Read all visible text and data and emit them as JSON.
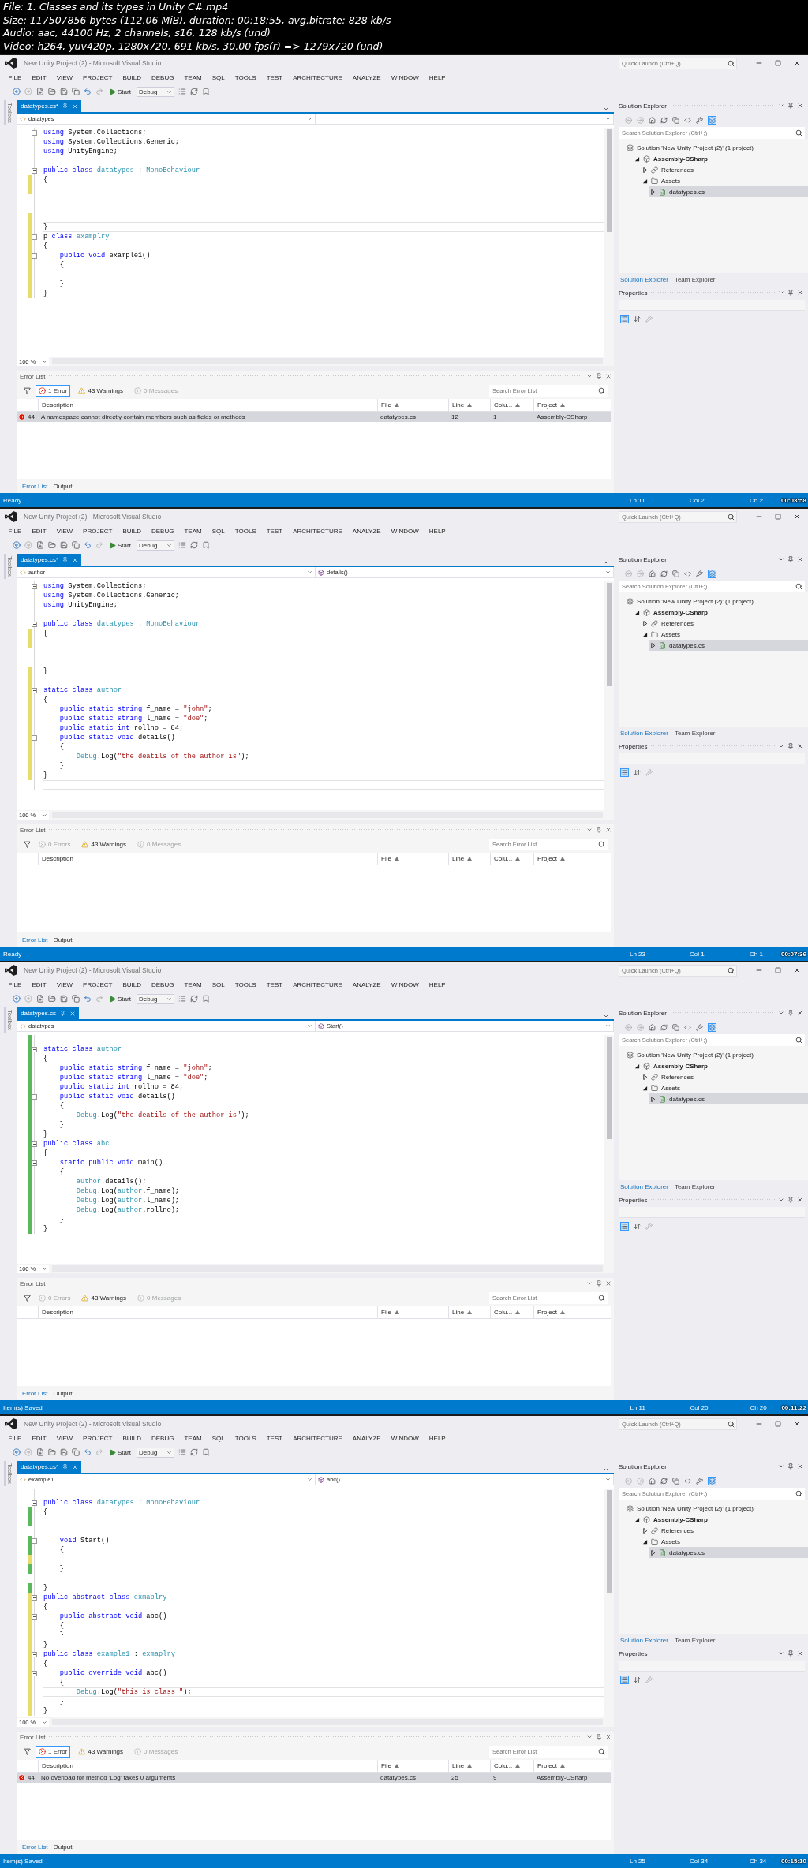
{
  "header": {
    "lines": [
      "File: 1. Classes and its types in Unity C#.mp4",
      "Size: 117507856 bytes (112.06 MiB), duration: 00:18:55, avg.bitrate: 828 kb/s",
      "Audio: aac, 44100 Hz, 2 channels, s16, 128 kb/s (und)",
      "Video: h264, yuv420p, 1280x720, 691 kb/s, 30.00 fps(r) => 1279x720 (und)"
    ]
  },
  "frames": [
    {
      "window": {
        "title": "New Unity Project (2) - Microsoft Visual Studio",
        "quick_launch": {
          "placeholder": "Quick Launch (Ctrl+Q)"
        }
      },
      "menu": [
        "FILE",
        "EDIT",
        "VIEW",
        "PROJECT",
        "BUILD",
        "DEBUG",
        "TEAM",
        "SQL",
        "TOOLS",
        "TEST",
        "ARCHITECTURE",
        "ANALYZE",
        "WINDOW",
        "HELP"
      ],
      "toolbar": {
        "start": "Start",
        "configuration": "Debug"
      },
      "toolbox": "Toolbox",
      "document_tab": {
        "label": "datatypes.cs*",
        "selected": true
      },
      "navigation": {
        "type": "datatypes"
      },
      "editor": {
        "lines": [
          {
            "fold": true,
            "current": false,
            "tokens": [
              {
                "kind": "keyword",
                "text": "using"
              },
              {
                "kind": "plain",
                "text": " System.Collections;"
              }
            ]
          },
          {
            "fold": false,
            "current": false,
            "tokens": [
              {
                "kind": "keyword",
                "text": "using"
              },
              {
                "kind": "plain",
                "text": " System.Collections.Generic;"
              }
            ]
          },
          {
            "fold": false,
            "current": false,
            "tokens": [
              {
                "kind": "keyword",
                "text": "using"
              },
              {
                "kind": "plain",
                "text": " UnityEngine;"
              }
            ]
          },
          {
            "fold": false,
            "current": false
          },
          {
            "fold": true,
            "current": false,
            "tokens": [
              {
                "kind": "keyword",
                "text": "public class "
              },
              {
                "kind": "type",
                "text": "datatypes"
              },
              {
                "kind": "plain",
                "text": " : "
              },
              {
                "kind": "type",
                "text": "MonoBehaviour"
              }
            ]
          },
          {
            "fold": false,
            "color": "#e8dc6a",
            "current": false,
            "tokens": [
              {
                "kind": "plain",
                "text": "{"
              }
            ]
          },
          {
            "fold": false,
            "color": "#e8dc6a",
            "current": false
          },
          {
            "fold": false,
            "current": false
          },
          {
            "fold": false,
            "current": false
          },
          {
            "fold": false,
            "color": "#e8dc6a",
            "current": false
          },
          {
            "fold": false,
            "color": "#e8dc6a",
            "current": true,
            "tokens": [
              {
                "kind": "plain",
                "text": "}"
              }
            ]
          },
          {
            "fold": true,
            "color": "#e8dc6a",
            "current": false,
            "tokens": [
              {
                "kind": "plain",
                "text": "p "
              },
              {
                "kind": "keyword",
                "text": "class "
              },
              {
                "kind": "type",
                "text": "examplry"
              }
            ]
          },
          {
            "fold": false,
            "color": "#e8dc6a",
            "current": false,
            "tokens": [
              {
                "kind": "plain",
                "text": "{"
              }
            ]
          },
          {
            "fold": true,
            "color": "#e8dc6a",
            "current": false,
            "tokens": [
              {
                "kind": "keyword",
                "text": "    public void"
              },
              {
                "kind": "plain",
                "text": " example1()"
              }
            ]
          },
          {
            "fold": false,
            "color": "#e8dc6a",
            "current": false,
            "tokens": [
              {
                "kind": "plain",
                "text": "    {"
              }
            ]
          },
          {
            "fold": false,
            "color": "#e8dc6a",
            "current": false
          },
          {
            "fold": false,
            "color": "#e8dc6a",
            "current": false,
            "tokens": [
              {
                "kind": "plain",
                "text": "    }"
              }
            ]
          },
          {
            "fold": false,
            "color": "#e8dc6a",
            "current": false,
            "tokens": [
              {
                "kind": "plain",
                "text": "}"
              }
            ]
          }
        ]
      },
      "zoom": "100 %",
      "error_list": {
        "title": "Error List",
        "filters": [
          {
            "kind": "error",
            "label": "1 Error",
            "selected": true,
            "disabled": false
          },
          {
            "kind": "warning",
            "label": "43 Warnings",
            "selected": false,
            "disabled": false
          },
          {
            "kind": "message",
            "label": "0 Messages",
            "selected": false,
            "disabled": true
          }
        ],
        "search": {
          "placeholder": "Search Error List"
        },
        "columns": [
          "Description",
          "File",
          "Line",
          "Colu...",
          "Project"
        ],
        "rows": [
          {
            "code": "44",
            "description": "A namespace cannot directly contain members such as fields or methods",
            "file": "datatypes.cs",
            "line": "12",
            "column": "1",
            "project": "Assembly-CSharp",
            "selected": true
          }
        ]
      },
      "bottom_tabs": [
        {
          "label": "Error List",
          "selected": true
        },
        {
          "label": "Output",
          "selected": false
        }
      ],
      "solution_explorer": {
        "title": "Solution Explorer",
        "search": {
          "placeholder": "Search Solution Explorer (Ctrl+;)"
        },
        "tree": [
          {
            "kind": "solution",
            "label": "Solution 'New Unity Project (2)' (1 project)",
            "selected": false,
            "children": [
              {
                "kind": "project",
                "label": "Assembly-CSharp",
                "expanded": true,
                "selected": false,
                "children": [
                  {
                    "kind": "references",
                    "label": "References",
                    "expanded": false,
                    "selected": false
                  },
                  {
                    "kind": "folder",
                    "label": "Assets",
                    "expanded": true,
                    "selected": false,
                    "children": [
                      {
                        "kind": "file",
                        "label": "datatypes.cs",
                        "expanded": false,
                        "selected": true
                      }
                    ]
                  }
                ]
              }
            ]
          }
        ],
        "tabs": [
          {
            "label": "Solution Explorer",
            "selected": true
          },
          {
            "label": "Team Explorer",
            "selected": false
          }
        ]
      },
      "properties": {
        "title": "Properties"
      },
      "status_bar": {
        "message": "Ready",
        "line": "Ln 11",
        "column": "Col 2",
        "char": "Ch 2",
        "timestamp": "00:03:58"
      }
    },
    {
      "window": {
        "title": "New Unity Project (2) - Microsoft Visual Studio",
        "quick_launch": {
          "placeholder": "Quick Launch (Ctrl+Q)"
        }
      },
      "menu": [
        "FILE",
        "EDIT",
        "VIEW",
        "PROJECT",
        "BUILD",
        "DEBUG",
        "TEAM",
        "SQL",
        "TOOLS",
        "TEST",
        "ARCHITECTURE",
        "ANALYZE",
        "WINDOW",
        "HELP"
      ],
      "toolbar": {
        "start": "Start",
        "configuration": "Debug"
      },
      "toolbox": "Toolbox",
      "document_tab": {
        "label": "datatypes.cs*",
        "selected": true
      },
      "navigation": {
        "type": "author",
        "member": "details()"
      },
      "editor": {
        "lines": [
          {
            "fold": true,
            "current": false,
            "tokens": [
              {
                "kind": "keyword",
                "text": "using"
              },
              {
                "kind": "plain",
                "text": " System.Collections;"
              }
            ]
          },
          {
            "fold": false,
            "current": false,
            "tokens": [
              {
                "kind": "keyword",
                "text": "using"
              },
              {
                "kind": "plain",
                "text": " System.Collections.Generic;"
              }
            ]
          },
          {
            "fold": false,
            "current": false,
            "tokens": [
              {
                "kind": "keyword",
                "text": "using"
              },
              {
                "kind": "plain",
                "text": " UnityEngine;"
              }
            ]
          },
          {
            "fold": false,
            "current": false
          },
          {
            "fold": true,
            "current": false,
            "tokens": [
              {
                "kind": "keyword",
                "text": "public class "
              },
              {
                "kind": "type",
                "text": "datatypes"
              },
              {
                "kind": "plain",
                "text": " : "
              },
              {
                "kind": "type",
                "text": "MonoBehaviour"
              }
            ]
          },
          {
            "fold": false,
            "color": "#e8dc6a",
            "current": false,
            "tokens": [
              {
                "kind": "plain",
                "text": "{"
              }
            ]
          },
          {
            "fold": false,
            "color": "#e8dc6a",
            "current": false
          },
          {
            "fold": false,
            "current": false
          },
          {
            "fold": false,
            "current": false
          },
          {
            "fold": false,
            "color": "#e8dc6a",
            "current": false,
            "tokens": [
              {
                "kind": "plain",
                "text": "}"
              }
            ]
          },
          {
            "fold": false,
            "color": "#e8dc6a",
            "current": false
          },
          {
            "fold": true,
            "color": "#e8dc6a",
            "current": false,
            "tokens": [
              {
                "kind": "keyword",
                "text": "static class "
              },
              {
                "kind": "type",
                "text": "author"
              }
            ]
          },
          {
            "fold": false,
            "color": "#e8dc6a",
            "current": false,
            "tokens": [
              {
                "kind": "plain",
                "text": "{"
              }
            ]
          },
          {
            "fold": false,
            "color": "#e8dc6a",
            "current": false,
            "tokens": [
              {
                "kind": "keyword",
                "text": "    public static string"
              },
              {
                "kind": "plain",
                "text": " f_name = "
              },
              {
                "kind": "string",
                "text": "\"john\""
              },
              {
                "kind": "plain",
                "text": ";"
              }
            ]
          },
          {
            "fold": false,
            "color": "#e8dc6a",
            "current": false,
            "tokens": [
              {
                "kind": "keyword",
                "text": "    public static string"
              },
              {
                "kind": "plain",
                "text": " l_name = "
              },
              {
                "kind": "string",
                "text": "\"doe\""
              },
              {
                "kind": "plain",
                "text": ";"
              }
            ]
          },
          {
            "fold": false,
            "color": "#e8dc6a",
            "current": false,
            "tokens": [
              {
                "kind": "keyword",
                "text": "    public static int"
              },
              {
                "kind": "plain",
                "text": " rollno = 84;"
              }
            ]
          },
          {
            "fold": true,
            "color": "#e8dc6a",
            "current": false,
            "tokens": [
              {
                "kind": "keyword",
                "text": "    public static void"
              },
              {
                "kind": "plain",
                "text": " details()"
              }
            ]
          },
          {
            "fold": false,
            "color": "#e8dc6a",
            "current": false,
            "tokens": [
              {
                "kind": "plain",
                "text": "    {"
              }
            ]
          },
          {
            "fold": false,
            "color": "#e8dc6a",
            "current": false,
            "tokens": [
              {
                "kind": "type",
                "text": "        Debug"
              },
              {
                "kind": "plain",
                "text": ".Log("
              },
              {
                "kind": "string",
                "text": "\"the deatils of the author is\""
              },
              {
                "kind": "plain",
                "text": ");"
              }
            ]
          },
          {
            "fold": false,
            "color": "#e8dc6a",
            "current": false,
            "tokens": [
              {
                "kind": "plain",
                "text": "    }"
              }
            ]
          },
          {
            "fold": false,
            "color": "#e8dc6a",
            "current": false,
            "tokens": [
              {
                "kind": "plain",
                "text": "}"
              }
            ]
          },
          {
            "fold": false,
            "current": true
          }
        ]
      },
      "zoom": "100 %",
      "error_list": {
        "title": "Error List",
        "filters": [
          {
            "kind": "error",
            "label": "0 Errors",
            "selected": false,
            "disabled": true
          },
          {
            "kind": "warning",
            "label": "43 Warnings",
            "selected": false,
            "disabled": false
          },
          {
            "kind": "message",
            "label": "0 Messages",
            "selected": false,
            "disabled": true
          }
        ],
        "search": {
          "placeholder": "Search Error List"
        },
        "columns": [
          "Description",
          "File",
          "Line",
          "Colu...",
          "Project"
        ]
      },
      "bottom_tabs": [
        {
          "label": "Error List",
          "selected": true
        },
        {
          "label": "Output",
          "selected": false
        }
      ],
      "solution_explorer": {
        "title": "Solution Explorer",
        "search": {
          "placeholder": "Search Solution Explorer (Ctrl+;)"
        },
        "tree": [
          {
            "kind": "solution",
            "label": "Solution 'New Unity Project (2)' (1 project)",
            "selected": false,
            "children": [
              {
                "kind": "project",
                "label": "Assembly-CSharp",
                "expanded": true,
                "selected": false,
                "children": [
                  {
                    "kind": "references",
                    "label": "References",
                    "expanded": false,
                    "selected": false
                  },
                  {
                    "kind": "folder",
                    "label": "Assets",
                    "expanded": true,
                    "selected": false,
                    "children": [
                      {
                        "kind": "file",
                        "label": "datatypes.cs",
                        "expanded": false,
                        "selected": true
                      }
                    ]
                  }
                ]
              }
            ]
          }
        ],
        "tabs": [
          {
            "label": "Solution Explorer",
            "selected": true
          },
          {
            "label": "Team Explorer",
            "selected": false
          }
        ]
      },
      "properties": {
        "title": "Properties"
      },
      "status_bar": {
        "message": "Ready",
        "line": "Ln 23",
        "column": "Col 1",
        "char": "Ch 1",
        "timestamp": "00:07:36"
      }
    },
    {
      "window": {
        "title": "New Unity Project (2) - Microsoft Visual Studio",
        "quick_launch": {
          "placeholder": "Quick Launch (Ctrl+Q)"
        }
      },
      "menu": [
        "FILE",
        "EDIT",
        "VIEW",
        "PROJECT",
        "BUILD",
        "DEBUG",
        "TEAM",
        "SQL",
        "TOOLS",
        "TEST",
        "ARCHITECTURE",
        "ANALYZE",
        "WINDOW",
        "HELP"
      ],
      "toolbar": {
        "start": "Start",
        "configuration": "Debug"
      },
      "toolbox": "Toolbox",
      "document_tab": {
        "label": "datatypes.cs",
        "selected": true
      },
      "navigation": {
        "type": "datatypes",
        "member": "Start()"
      },
      "editor": {
        "lines": [
          {
            "fold": false,
            "color": "#5cb85c",
            "current": false
          },
          {
            "fold": true,
            "color": "#5cb85c",
            "current": false,
            "tokens": [
              {
                "kind": "keyword",
                "text": "static class "
              },
              {
                "kind": "type",
                "text": "author"
              }
            ]
          },
          {
            "fold": false,
            "color": "#5cb85c",
            "current": false,
            "tokens": [
              {
                "kind": "plain",
                "text": "{"
              }
            ]
          },
          {
            "fold": false,
            "color": "#5cb85c",
            "current": false,
            "tokens": [
              {
                "kind": "keyword",
                "text": "    public static string"
              },
              {
                "kind": "plain",
                "text": " f_name = "
              },
              {
                "kind": "string",
                "text": "\"john\""
              },
              {
                "kind": "plain",
                "text": ";"
              }
            ]
          },
          {
            "fold": false,
            "color": "#5cb85c",
            "current": false,
            "tokens": [
              {
                "kind": "keyword",
                "text": "    public static string"
              },
              {
                "kind": "plain",
                "text": " l_name = "
              },
              {
                "kind": "string",
                "text": "\"doe\""
              },
              {
                "kind": "plain",
                "text": ";"
              }
            ]
          },
          {
            "fold": false,
            "color": "#5cb85c",
            "current": false,
            "tokens": [
              {
                "kind": "keyword",
                "text": "    public static int"
              },
              {
                "kind": "plain",
                "text": " rollno = 84;"
              }
            ]
          },
          {
            "fold": true,
            "color": "#5cb85c",
            "current": false,
            "tokens": [
              {
                "kind": "keyword",
                "text": "    public static void"
              },
              {
                "kind": "plain",
                "text": " details()"
              }
            ]
          },
          {
            "fold": false,
            "color": "#5cb85c",
            "current": false,
            "tokens": [
              {
                "kind": "plain",
                "text": "    {"
              }
            ]
          },
          {
            "fold": false,
            "color": "#5cb85c",
            "current": false,
            "tokens": [
              {
                "kind": "type",
                "text": "        Debug"
              },
              {
                "kind": "plain",
                "text": ".Log("
              },
              {
                "kind": "string",
                "text": "\"the deatils of the author is\""
              },
              {
                "kind": "plain",
                "text": ");"
              }
            ]
          },
          {
            "fold": false,
            "color": "#5cb85c",
            "current": false,
            "tokens": [
              {
                "kind": "plain",
                "text": "    }"
              }
            ]
          },
          {
            "fold": false,
            "color": "#5cb85c",
            "current": false,
            "tokens": [
              {
                "kind": "plain",
                "text": "}"
              }
            ]
          },
          {
            "fold": true,
            "color": "#5cb85c",
            "current": false,
            "tokens": [
              {
                "kind": "keyword",
                "text": "public class "
              },
              {
                "kind": "type",
                "text": "abc"
              }
            ]
          },
          {
            "fold": false,
            "color": "#5cb85c",
            "current": false,
            "tokens": [
              {
                "kind": "plain",
                "text": "{"
              }
            ]
          },
          {
            "fold": true,
            "color": "#5cb85c",
            "current": false,
            "tokens": [
              {
                "kind": "keyword",
                "text": "    static public void"
              },
              {
                "kind": "plain",
                "text": " main()"
              }
            ]
          },
          {
            "fold": false,
            "color": "#5cb85c",
            "current": false,
            "tokens": [
              {
                "kind": "plain",
                "text": "    {"
              }
            ]
          },
          {
            "fold": false,
            "color": "#5cb85c",
            "current": false,
            "tokens": [
              {
                "kind": "type",
                "text": "        author"
              },
              {
                "kind": "plain",
                "text": ".details();"
              }
            ]
          },
          {
            "fold": false,
            "color": "#5cb85c",
            "current": false,
            "tokens": [
              {
                "kind": "type",
                "text": "        Debug"
              },
              {
                "kind": "plain",
                "text": ".Log("
              },
              {
                "kind": "type",
                "text": "author"
              },
              {
                "kind": "plain",
                "text": ".f_name);"
              }
            ]
          },
          {
            "fold": false,
            "color": "#5cb85c",
            "current": false,
            "tokens": [
              {
                "kind": "type",
                "text": "        Debug"
              },
              {
                "kind": "plain",
                "text": ".Log("
              },
              {
                "kind": "type",
                "text": "author"
              },
              {
                "kind": "plain",
                "text": ".l_name);"
              }
            ]
          },
          {
            "fold": false,
            "color": "#5cb85c",
            "current": false,
            "tokens": [
              {
                "kind": "type",
                "text": "        Debug"
              },
              {
                "kind": "plain",
                "text": ".Log("
              },
              {
                "kind": "type",
                "text": "author"
              },
              {
                "kind": "plain",
                "text": ".rollno);"
              }
            ]
          },
          {
            "fold": false,
            "color": "#5cb85c",
            "current": false,
            "tokens": [
              {
                "kind": "plain",
                "text": "    }"
              }
            ]
          },
          {
            "fold": false,
            "color": "#5cb85c",
            "current": false,
            "tokens": [
              {
                "kind": "plain",
                "text": "}"
              }
            ]
          }
        ]
      },
      "zoom": "100 %",
      "error_list": {
        "title": "Error List",
        "filters": [
          {
            "kind": "error",
            "label": "0 Errors",
            "selected": false,
            "disabled": true
          },
          {
            "kind": "warning",
            "label": "43 Warnings",
            "selected": false,
            "disabled": false
          },
          {
            "kind": "message",
            "label": "0 Messages",
            "selected": false,
            "disabled": true
          }
        ],
        "search": {
          "placeholder": "Search Error List"
        },
        "columns": [
          "Description",
          "File",
          "Line",
          "Colu...",
          "Project"
        ]
      },
      "bottom_tabs": [
        {
          "label": "Error List",
          "selected": true
        },
        {
          "label": "Output",
          "selected": false
        }
      ],
      "solution_explorer": {
        "title": "Solution Explorer",
        "search": {
          "placeholder": "Search Solution Explorer (Ctrl+;)"
        },
        "tree": [
          {
            "kind": "solution",
            "label": "Solution 'New Unity Project (2)' (1 project)",
            "selected": false,
            "children": [
              {
                "kind": "project",
                "label": "Assembly-CSharp",
                "expanded": true,
                "selected": false,
                "children": [
                  {
                    "kind": "references",
                    "label": "References",
                    "expanded": false,
                    "selected": false
                  },
                  {
                    "kind": "folder",
                    "label": "Assets",
                    "expanded": true,
                    "selected": false,
                    "children": [
                      {
                        "kind": "file",
                        "label": "datatypes.cs",
                        "expanded": false,
                        "selected": true
                      }
                    ]
                  }
                ]
              }
            ]
          }
        ],
        "tabs": [
          {
            "label": "Solution Explorer",
            "selected": true
          },
          {
            "label": "Team Explorer",
            "selected": false
          }
        ]
      },
      "properties": {
        "title": "Properties"
      },
      "status_bar": {
        "message": "Item(s) Saved",
        "line": "Ln 11",
        "column": "Col 20",
        "char": "Ch 20",
        "timestamp": "00:11:22"
      }
    },
    {
      "window": {
        "title": "New Unity Project (2) - Microsoft Visual Studio",
        "quick_launch": {
          "placeholder": "Quick Launch (Ctrl+Q)"
        }
      },
      "menu": [
        "FILE",
        "EDIT",
        "VIEW",
        "PROJECT",
        "BUILD",
        "DEBUG",
        "TEAM",
        "SQL",
        "TOOLS",
        "TEST",
        "ARCHITECTURE",
        "ANALYZE",
        "WINDOW",
        "HELP"
      ],
      "toolbar": {
        "start": "Start",
        "configuration": "Debug"
      },
      "toolbox": "Toolbox",
      "document_tab": {
        "label": "datatypes.cs*",
        "selected": true
      },
      "navigation": {
        "type": "example1",
        "member": "abc()"
      },
      "editor": {
        "lines": [
          {
            "fold": false,
            "current": false
          },
          {
            "fold": true,
            "current": false,
            "tokens": [
              {
                "kind": "keyword",
                "text": "public class "
              },
              {
                "kind": "type",
                "text": "datatypes"
              },
              {
                "kind": "plain",
                "text": " : "
              },
              {
                "kind": "type",
                "text": "MonoBehaviour"
              }
            ]
          },
          {
            "fold": false,
            "color": "#5cb85c",
            "current": false,
            "tokens": [
              {
                "kind": "plain",
                "text": "{"
              }
            ]
          },
          {
            "fold": false,
            "color": "#5cb85c",
            "current": false
          },
          {
            "fold": false,
            "current": false
          },
          {
            "fold": true,
            "color": "#5cb85c",
            "current": false,
            "tokens": [
              {
                "kind": "keyword",
                "text": "    void"
              },
              {
                "kind": "plain",
                "text": " Start()"
              }
            ]
          },
          {
            "fold": false,
            "color": "#5cb85c",
            "current": false,
            "tokens": [
              {
                "kind": "plain",
                "text": "    {"
              }
            ]
          },
          {
            "fold": false,
            "color": "#e8dc6a",
            "current": false
          },
          {
            "fold": false,
            "color": "#5cb85c",
            "current": false,
            "tokens": [
              {
                "kind": "plain",
                "text": "    }"
              }
            ]
          },
          {
            "fold": false,
            "current": false
          },
          {
            "fold": false,
            "color": "#5cb85c",
            "current": false,
            "tokens": [
              {
                "kind": "plain",
                "text": "}"
              }
            ]
          },
          {
            "fold": true,
            "color": "#e8dc6a",
            "current": false,
            "tokens": [
              {
                "kind": "keyword",
                "text": "public abstract class "
              },
              {
                "kind": "type",
                "text": "exmaplry"
              }
            ]
          },
          {
            "fold": false,
            "color": "#e8dc6a",
            "current": false,
            "tokens": [
              {
                "kind": "plain",
                "text": "{"
              }
            ]
          },
          {
            "fold": true,
            "color": "#e8dc6a",
            "current": false,
            "tokens": [
              {
                "kind": "keyword",
                "text": "    public abstract void"
              },
              {
                "kind": "plain",
                "text": " abc()"
              }
            ]
          },
          {
            "fold": false,
            "color": "#e8dc6a",
            "current": false,
            "tokens": [
              {
                "kind": "plain",
                "text": "    {"
              }
            ]
          },
          {
            "fold": false,
            "color": "#e8dc6a",
            "current": false,
            "tokens": [
              {
                "kind": "plain",
                "text": "    }"
              }
            ]
          },
          {
            "fold": false,
            "color": "#e8dc6a",
            "current": false,
            "tokens": [
              {
                "kind": "plain",
                "text": "}"
              }
            ]
          },
          {
            "fold": true,
            "color": "#e8dc6a",
            "current": false,
            "tokens": [
              {
                "kind": "keyword",
                "text": "public class "
              },
              {
                "kind": "type",
                "text": "example1"
              },
              {
                "kind": "plain",
                "text": " : "
              },
              {
                "kind": "type",
                "text": "exmaplry"
              }
            ]
          },
          {
            "fold": false,
            "color": "#e8dc6a",
            "current": false,
            "tokens": [
              {
                "kind": "plain",
                "text": "{"
              }
            ]
          },
          {
            "fold": true,
            "color": "#e8dc6a",
            "current": false,
            "tokens": [
              {
                "kind": "keyword",
                "text": "    public override void"
              },
              {
                "kind": "plain",
                "text": " abc()"
              }
            ]
          },
          {
            "fold": false,
            "color": "#e8dc6a",
            "current": false,
            "tokens": [
              {
                "kind": "plain",
                "text": "    {"
              }
            ]
          },
          {
            "fold": false,
            "color": "#e8dc6a",
            "current": true,
            "tokens": [
              {
                "kind": "type",
                "text": "        Debug"
              },
              {
                "kind": "plain",
                "text": ".Log("
              },
              {
                "kind": "string",
                "text": "\"this is class \""
              },
              {
                "kind": "plain",
                "text": ");"
              }
            ]
          },
          {
            "fold": false,
            "color": "#e8dc6a",
            "current": false,
            "tokens": [
              {
                "kind": "plain",
                "text": "    }"
              }
            ]
          },
          {
            "fold": false,
            "color": "#e8dc6a",
            "current": false,
            "tokens": [
              {
                "kind": "plain",
                "text": "}"
              }
            ]
          }
        ]
      },
      "zoom": "100 %",
      "error_list": {
        "title": "Error List",
        "filters": [
          {
            "kind": "error",
            "label": "1 Error",
            "selected": true,
            "disabled": false
          },
          {
            "kind": "warning",
            "label": "43 Warnings",
            "selected": false,
            "disabled": false
          },
          {
            "kind": "message",
            "label": "0 Messages",
            "selected": false,
            "disabled": true
          }
        ],
        "search": {
          "placeholder": "Search Error List"
        },
        "columns": [
          "Description",
          "File",
          "Line",
          "Colu...",
          "Project"
        ],
        "rows": [
          {
            "code": "44",
            "description": "No overload for method 'Log' takes 0 arguments",
            "file": "datatypes.cs",
            "line": "25",
            "column": "9",
            "project": "Assembly-CSharp",
            "selected": true
          }
        ]
      },
      "bottom_tabs": [
        {
          "label": "Error List",
          "selected": true
        },
        {
          "label": "Output",
          "selected": false
        }
      ],
      "solution_explorer": {
        "title": "Solution Explorer",
        "search": {
          "placeholder": "Search Solution Explorer (Ctrl+;)"
        },
        "tree": [
          {
            "kind": "solution",
            "label": "Solution 'New Unity Project (2)' (1 project)",
            "selected": false,
            "children": [
              {
                "kind": "project",
                "label": "Assembly-CSharp",
                "expanded": true,
                "selected": false,
                "children": [
                  {
                    "kind": "references",
                    "label": "References",
                    "expanded": false,
                    "selected": false
                  },
                  {
                    "kind": "folder",
                    "label": "Assets",
                    "expanded": true,
                    "selected": false,
                    "children": [
                      {
                        "kind": "file",
                        "label": "datatypes.cs",
                        "expanded": false,
                        "selected": true
                      }
                    ]
                  }
                ]
              }
            ]
          }
        ],
        "tabs": [
          {
            "label": "Solution Explorer",
            "selected": true
          },
          {
            "label": "Team Explorer",
            "selected": false
          }
        ]
      },
      "properties": {
        "title": "Properties"
      },
      "status_bar": {
        "message": "Item(s) Saved",
        "line": "Ln 25",
        "column": "Col 34",
        "char": "Ch 34",
        "timestamp": "00:15:10"
      }
    }
  ]
}
